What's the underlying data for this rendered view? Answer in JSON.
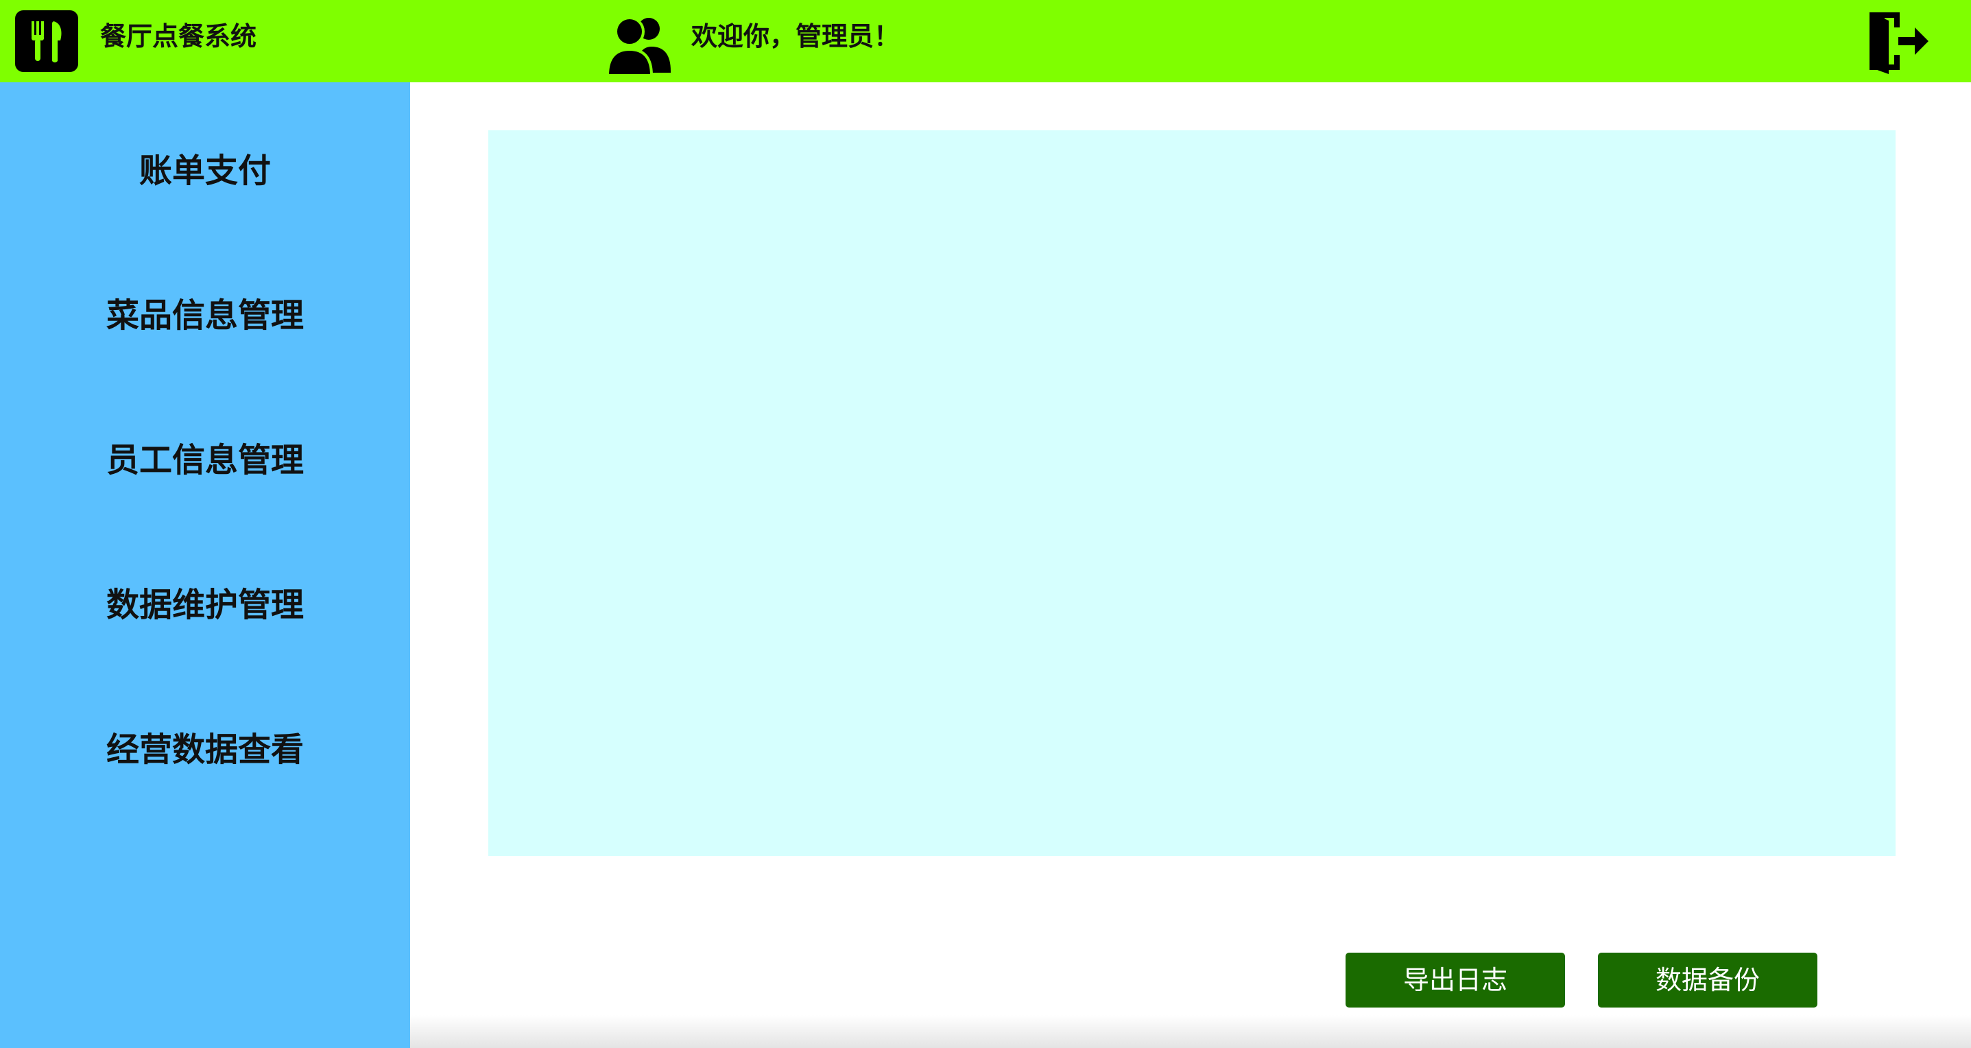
{
  "header": {
    "app_title": "餐厅点餐系统",
    "welcome": "欢迎你，管理员！",
    "logo_icon": "fork-knife-icon",
    "user_icon": "users-icon",
    "logout_icon": "logout-icon"
  },
  "sidebar": {
    "items": [
      {
        "label": "账单支付"
      },
      {
        "label": "菜品信息管理"
      },
      {
        "label": "员工信息管理"
      },
      {
        "label": "数据维护管理"
      },
      {
        "label": "经营数据查看"
      }
    ]
  },
  "main": {
    "buttons": {
      "export_log": "导出日志",
      "backup": "数据备份"
    }
  },
  "colors": {
    "header": "#7fff00",
    "sidebar": "#5bc0fe",
    "panel": "#d6fffe",
    "button": "#1a6b00"
  }
}
